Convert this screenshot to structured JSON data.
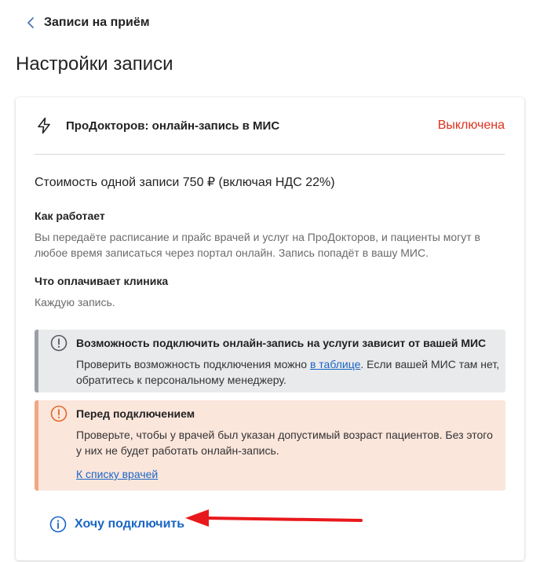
{
  "header": {
    "back_label": "Записи на приём",
    "page_title": "Настройки записи"
  },
  "card": {
    "title": "ПроДокторов: онлайн-запись в МИС",
    "status": "Выключена",
    "price": "Стоимость одной записи 750 ₽ (включая НДС 22%)",
    "how_title": "Как работает",
    "how_text": "Вы передаёте расписание и прайс врачей и услуг на ПроДокторов, и пациенты могут в любое время записаться через портал онлайн. Запись попадёт в вашу МИС.",
    "pay_title": "Что оплачивает клиника",
    "pay_text": "Каждую запись."
  },
  "alert_mis": {
    "title": "Возможность подключить онлайн-запись на услуги зависит от вашей МИС",
    "text_before": "Проверить возможность подключения можно ",
    "link": "в таблице",
    "text_after": ". Если вашей МИС там нет, обратитесь к персональному менеджеру."
  },
  "alert_before": {
    "title": "Перед подключением",
    "text": "Проверьте, чтобы у врачей был указан допустимый возраст пациентов. Без этого у них не будет работать онлайн-запись.",
    "link": "К списку врачей"
  },
  "connect_label": "Хочу подключить",
  "colors": {
    "status_red": "#e0301e",
    "link_blue": "#1a66c5",
    "grey_alert_bg": "#e9eaec",
    "orange_alert_bg": "#fbe6dc",
    "annotation_arrow": "#e8191c"
  },
  "icons": {
    "back": "chevron-left-icon",
    "card": "lightning-icon",
    "alert_mis": "exclamation-circle-icon",
    "alert_before": "exclamation-circle-icon",
    "connect": "info-circle-icon"
  }
}
